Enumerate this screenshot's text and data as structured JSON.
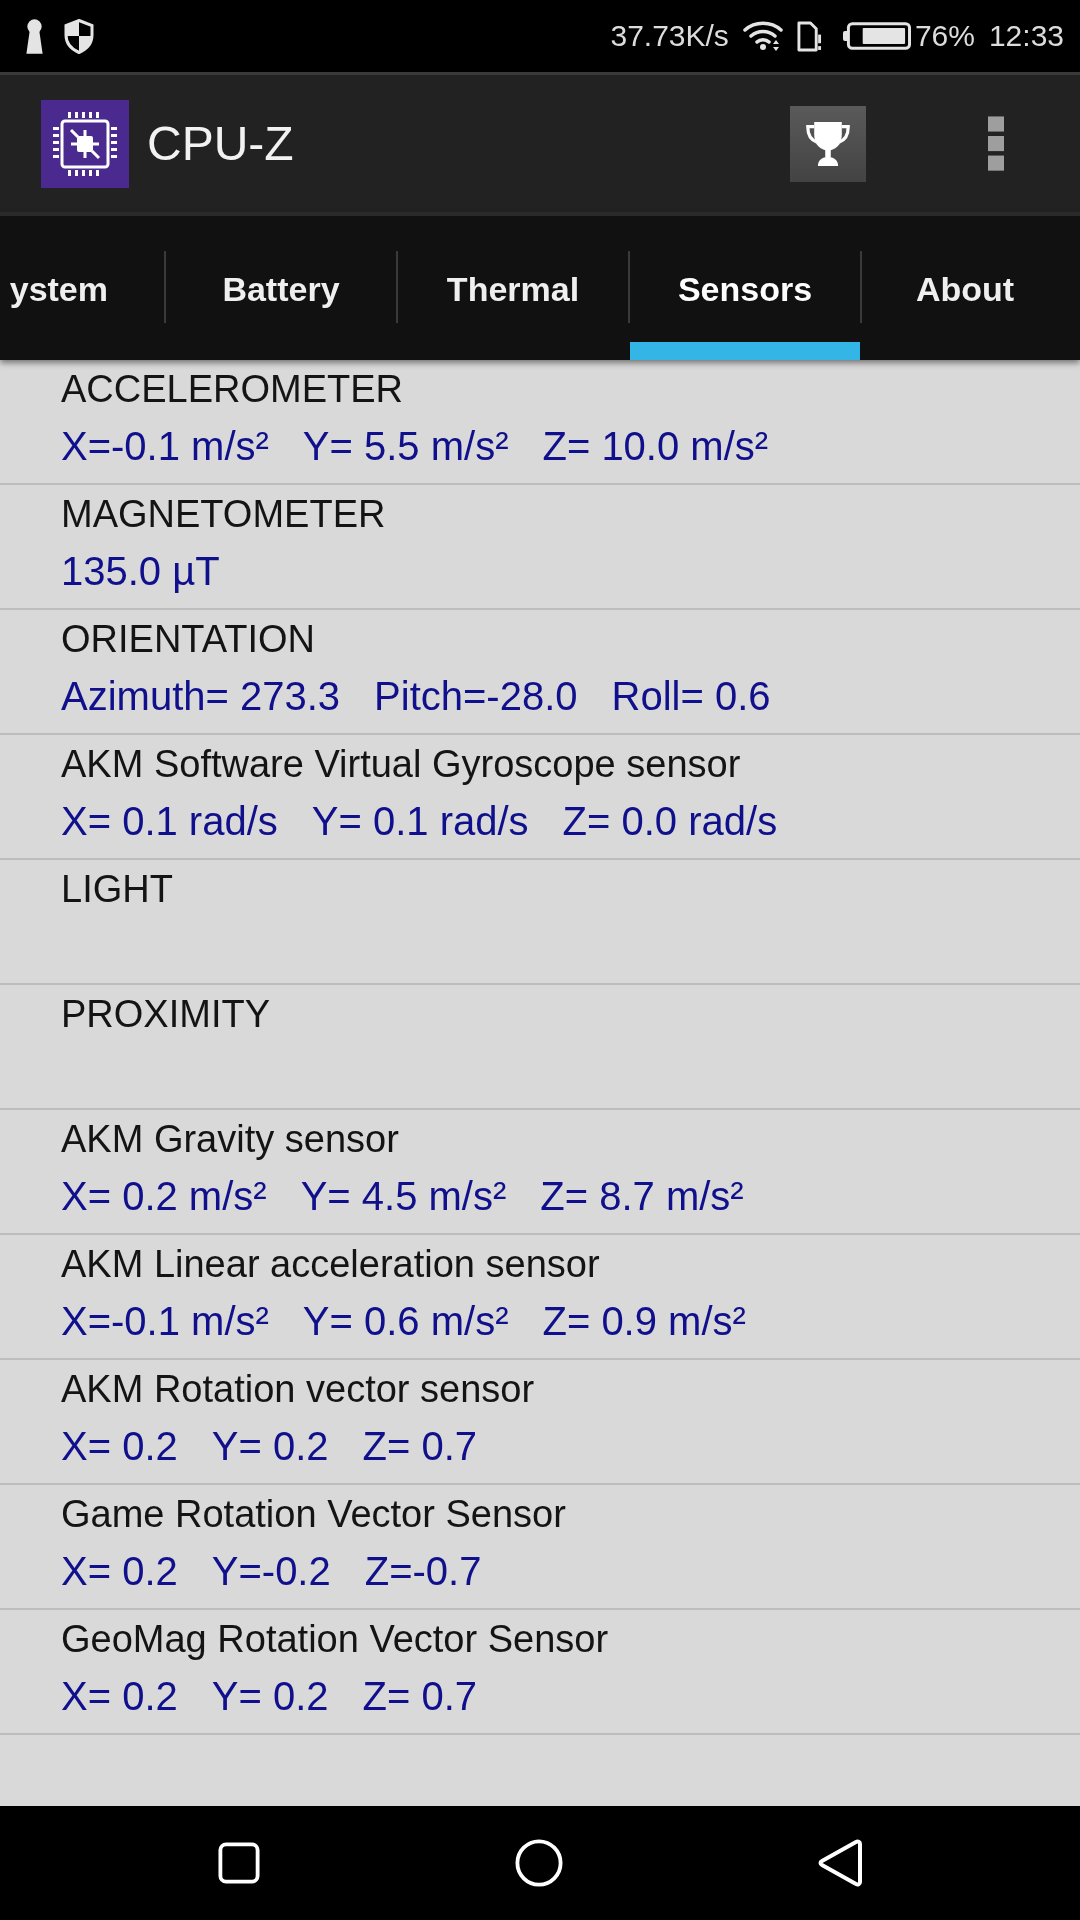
{
  "status_bar": {
    "network_speed": "37.73K/s",
    "battery_percent": "76%",
    "time": "12:33"
  },
  "app_bar": {
    "title": "CPU-Z"
  },
  "tabs": [
    {
      "label": "ystem",
      "selected": false
    },
    {
      "label": "Battery",
      "selected": false
    },
    {
      "label": "Thermal",
      "selected": false
    },
    {
      "label": "Sensors",
      "selected": true
    },
    {
      "label": "About",
      "selected": false
    }
  ],
  "sensors": [
    {
      "name": "ACCELEROMETER",
      "values": [
        "X=-0.1 m/s²",
        "Y= 5.5 m/s²",
        "Z= 10.0 m/s²"
      ]
    },
    {
      "name": "MAGNETOMETER",
      "values": [
        "135.0 µT"
      ]
    },
    {
      "name": "ORIENTATION",
      "values": [
        "Azimuth= 273.3",
        "Pitch=-28.0",
        "Roll= 0.6"
      ]
    },
    {
      "name": "AKM Software Virtual Gyroscope sensor",
      "values": [
        "X= 0.1 rad/s",
        "Y= 0.1 rad/s",
        "Z= 0.0 rad/s"
      ]
    },
    {
      "name": "LIGHT"
    },
    {
      "name": "PROXIMITY"
    },
    {
      "name": "AKM Gravity sensor",
      "values": [
        "X= 0.2 m/s²",
        "Y= 4.5 m/s²",
        "Z= 8.7 m/s²"
      ]
    },
    {
      "name": "AKM Linear acceleration sensor",
      "values": [
        "X=-0.1 m/s²",
        "Y= 0.6 m/s²",
        "Z= 0.9 m/s²"
      ]
    },
    {
      "name": "AKM Rotation vector sensor",
      "values": [
        "X= 0.2",
        "Y= 0.2",
        "Z= 0.7"
      ]
    },
    {
      "name": "Game Rotation Vector Sensor",
      "values": [
        "X= 0.2",
        "Y=-0.2",
        "Z=-0.7"
      ]
    },
    {
      "name": "GeoMag Rotation Vector Sensor",
      "values": [
        "X= 0.2",
        "Y= 0.2",
        "Z= 0.7"
      ]
    }
  ]
}
